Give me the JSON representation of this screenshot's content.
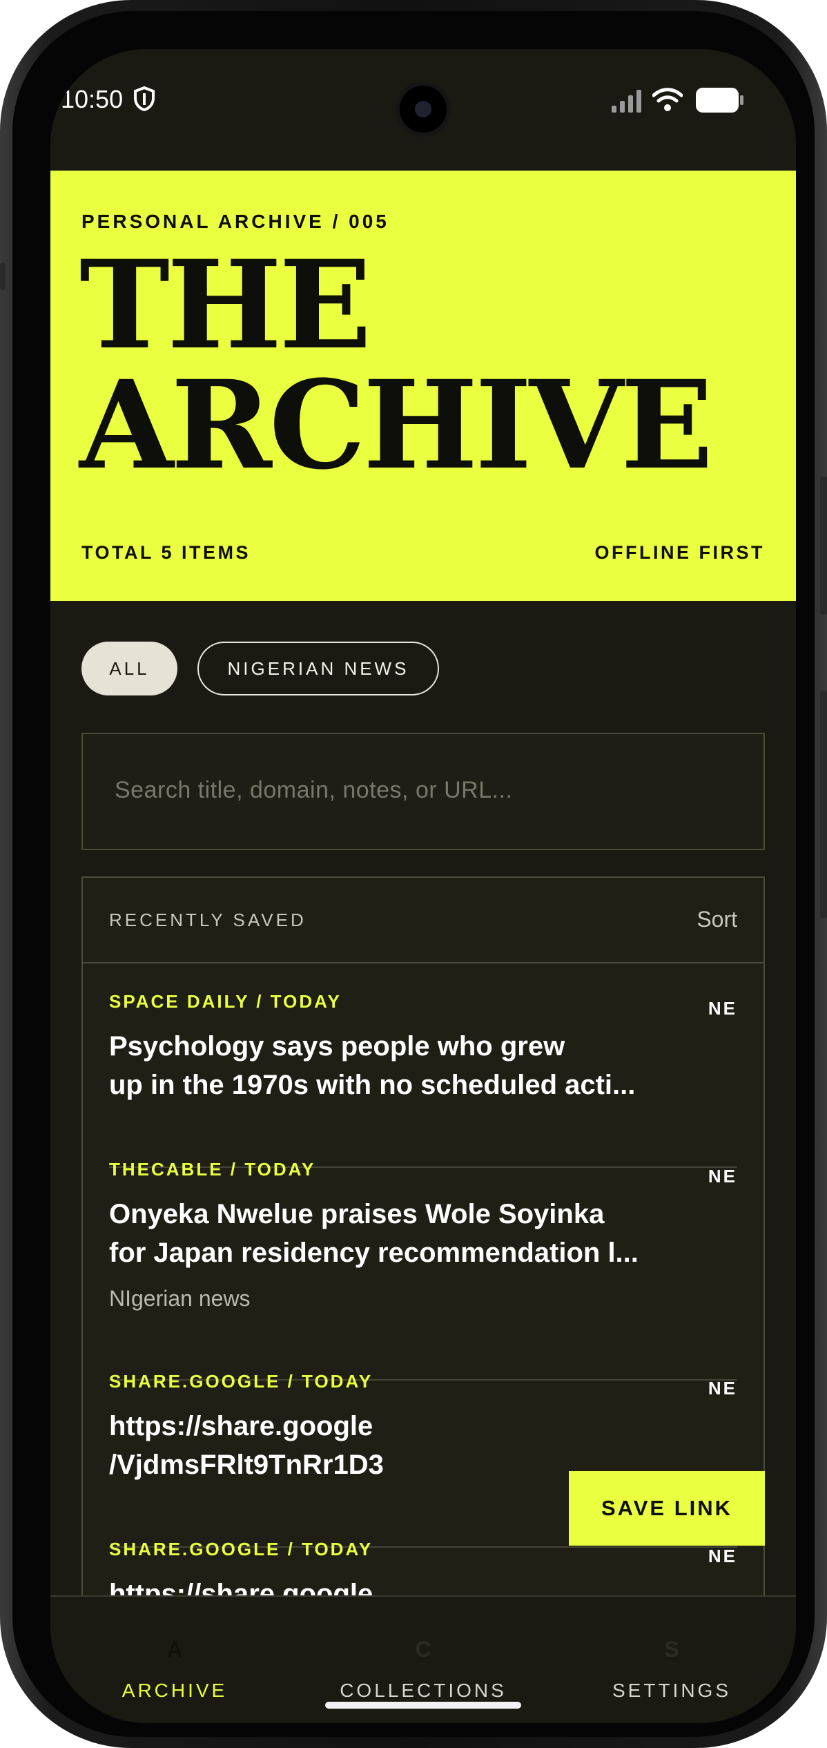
{
  "status": {
    "time": "10:50"
  },
  "hero": {
    "eyebrow": "PERSONAL ARCHIVE / 005",
    "title_line1": "THE",
    "title_line2": "ARCHIVE",
    "total": "TOTAL 5 ITEMS",
    "mode": "OFFLINE FIRST"
  },
  "filters": [
    {
      "label": "ALL",
      "active": true
    },
    {
      "label": "NIGERIAN NEWS",
      "active": false
    }
  ],
  "search": {
    "placeholder": "Search title, domain, notes, or URL..."
  },
  "list": {
    "heading": "RECENTLY SAVED",
    "sort_label": "Sort",
    "items": [
      {
        "source": "SPACE DAILY / TODAY",
        "tag": "NE",
        "title": "Psychology says people who grew\nup in the 1970s with no scheduled acti...",
        "note": ""
      },
      {
        "source": "THECABLE / TODAY",
        "tag": "NE",
        "title": "Onyeka Nwelue praises Wole Soyinka\nfor Japan residency recommendation l...",
        "note": "NIgerian news"
      },
      {
        "source": "SHARE.GOOGLE / TODAY",
        "tag": "NE",
        "title": "https://share.google\n/VjdmsFRlt9TnRr1D3",
        "note": ""
      },
      {
        "source": "SHARE.GOOGLE / TODAY",
        "tag": "NE",
        "title": "https://share.google",
        "note": ""
      }
    ]
  },
  "save_button": "SAVE LINK",
  "nav": [
    {
      "letter": "A",
      "label": "ARCHIVE",
      "active": true
    },
    {
      "letter": "C",
      "label": "COLLECTIONS",
      "active": false
    },
    {
      "letter": "S",
      "label": "SETTINGS",
      "active": false
    }
  ],
  "colors": {
    "accent": "#eaff3f",
    "background": "#1a1a12"
  }
}
